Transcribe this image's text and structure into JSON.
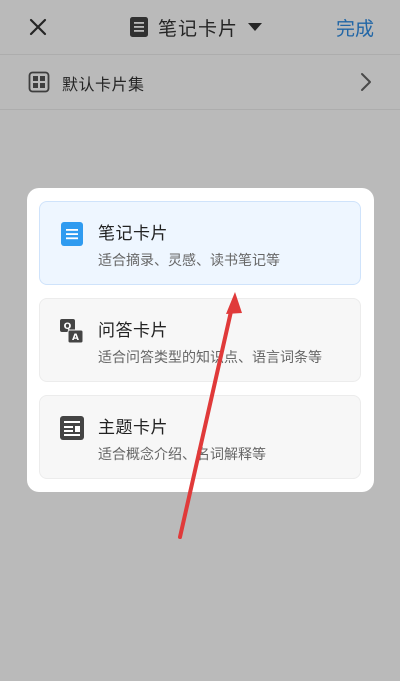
{
  "header": {
    "close_icon": "close-icon",
    "title": "笔记卡片",
    "done_label": "完成"
  },
  "card_set": {
    "label": "默认卡片集"
  },
  "card_types": [
    {
      "title": "笔记卡片",
      "description": "适合摘录、灵感、读书笔记等",
      "icon": "note-doc-icon",
      "selected": true
    },
    {
      "title": "问答卡片",
      "description": "适合问答类型的知识点、语言词条等",
      "icon": "qa-icon",
      "selected": false
    },
    {
      "title": "主题卡片",
      "description": "适合概念介绍、名词解释等",
      "icon": "topic-icon",
      "selected": false
    }
  ],
  "colors": {
    "accent": "#2f8de4",
    "selected_bg": "#eef6ff",
    "annotation_arrow": "#e03a3a"
  }
}
